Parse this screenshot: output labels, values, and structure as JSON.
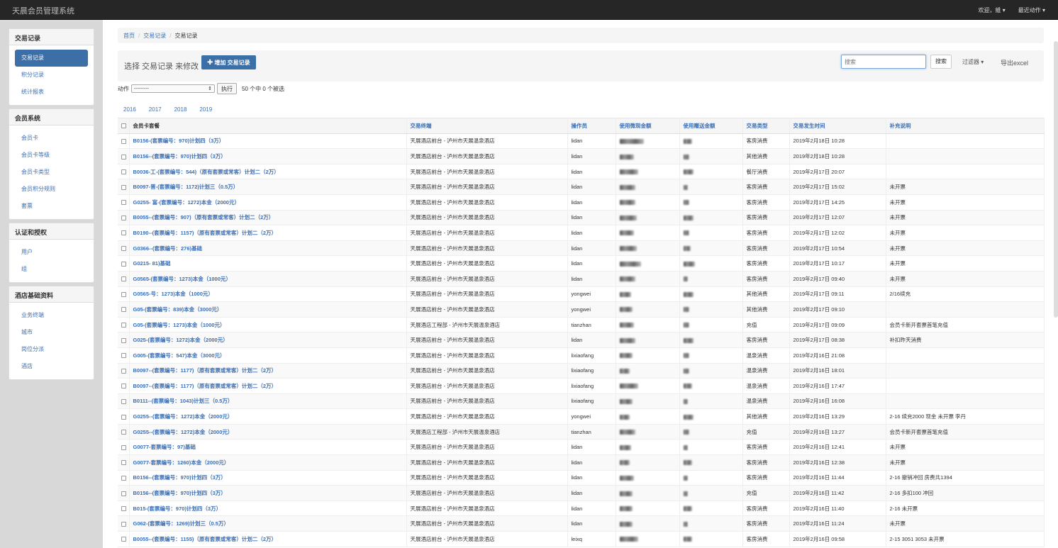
{
  "app": {
    "title": "天晨会员管理系统",
    "welcome": "欢迎，",
    "user": "維",
    "recent": "最近动作"
  },
  "sidebar": [
    {
      "heading": "交易记录",
      "items": [
        {
          "label": "交易记录",
          "active": true
        },
        {
          "label": "积分记录"
        },
        {
          "label": "统计报表"
        }
      ]
    },
    {
      "heading": "会员系统",
      "items": [
        {
          "label": "会员卡"
        },
        {
          "label": "会员卡等级"
        },
        {
          "label": "会员卡类型"
        },
        {
          "label": "会员积分规则"
        },
        {
          "label": "套票"
        }
      ]
    },
    {
      "heading": "认证和授权",
      "items": [
        {
          "label": "用户"
        },
        {
          "label": "组"
        }
      ]
    },
    {
      "heading": "酒店基础资料",
      "items": [
        {
          "label": "业务终端"
        },
        {
          "label": "城市"
        },
        {
          "label": "岗位分派"
        },
        {
          "label": "酒店"
        }
      ]
    }
  ],
  "breadcrumb": {
    "home": "首页",
    "section": "交易记录",
    "current": "交易记录"
  },
  "toolbar": {
    "title": "选择 交易记录 来修改",
    "add_label": "增加 交易记录",
    "search_placeholder": "搜索",
    "search_label": "搜索",
    "filter_label": "过滤器",
    "export_label": "导出excel"
  },
  "actions": {
    "label": "动作",
    "select_value": "---------",
    "go_label": "执行",
    "selection_info": "50 个中 0 个被选"
  },
  "years": [
    "2016",
    "2017",
    "2018",
    "2019"
  ],
  "table": {
    "headers": [
      "会员卡套餐",
      "交易终端",
      "操作员",
      "使用微现金额",
      "使用赠送金额",
      "交易类型",
      "交易发生时间",
      "补充说明"
    ],
    "rows": [
      {
        "card": "B0156-(套票编号：970)计划四（3万）",
        "terminal": "天展酒店前台 - 泸州市天展温泉酒店",
        "op": "lidan",
        "type": "客房消费",
        "time": "2019年2月18日 10:28",
        "note": ""
      },
      {
        "card": "B0156--(套票编号：970)计划四（3万）",
        "terminal": "天展酒店前台 - 泸州市天展温泉酒店",
        "op": "lidan",
        "type": "其他消费",
        "time": "2019年2月18日 10:28",
        "note": ""
      },
      {
        "card": "B0036-工-(套票编号：544)（原有套票或常客）计划二（2万）",
        "terminal": "天展酒店前台 - 泸州市天展温泉酒店",
        "op": "lidan",
        "type": "餐厅消费",
        "time": "2019年2月17日 20:07",
        "note": ""
      },
      {
        "card": "B0097-晋-(套票编号：1172)计划三（0.5万）",
        "terminal": "天展酒店前台 - 泸州市天展温泉酒店",
        "op": "lidan",
        "type": "客房消费",
        "time": "2019年2月17日 15:02",
        "note": "未开票"
      },
      {
        "card": "G0255- 富-(套票编号：1272)本金（2000元）",
        "terminal": "天展酒店前台 - 泸州市天展温泉酒店",
        "op": "lidan",
        "type": "客房消费",
        "time": "2019年2月17日 14:25",
        "note": "未开票"
      },
      {
        "card": "B0055--(套票编号：907)（原有套票或常客）计划二（2万）",
        "terminal": "天展酒店前台 - 泸州市天展温泉酒店",
        "op": "lidan",
        "type": "客房消费",
        "time": "2019年2月17日 12:07",
        "note": "未开票"
      },
      {
        "card": "B0190--(套票编号：1157)（原有套票或常客）计划二（2万）",
        "terminal": "天展酒店前台 - 泸州市天展温泉酒店",
        "op": "lidan",
        "type": "客房消费",
        "time": "2019年2月17日 12:02",
        "note": "未开票"
      },
      {
        "card": "G0366--(套票编号：276)基础",
        "terminal": "天展酒店前台 - 泸州市天展温泉酒店",
        "op": "lidan",
        "type": "客房消费",
        "time": "2019年2月17日 10:54",
        "note": "未开票"
      },
      {
        "card": "G0215- 81)基础",
        "terminal": "天展酒店前台 - 泸州市天展温泉酒店",
        "op": "lidan",
        "type": "客房消费",
        "time": "2019年2月17日 10:17",
        "note": "未开票"
      },
      {
        "card": "G0565-(套票编号：1273)本金（1000元）",
        "terminal": "天展酒店前台 - 泸州市天展温泉酒店",
        "op": "lidan",
        "type": "客房消费",
        "time": "2019年2月17日 09:40",
        "note": "未开票"
      },
      {
        "card": "G0565-号：1273)本金（1000元）",
        "terminal": "天展酒店前台 - 泸州市天展温泉酒店",
        "op": "yongwei",
        "type": "其他消费",
        "time": "2019年2月17日 09:11",
        "note": "2/16续充"
      },
      {
        "card": "G05-(套票编号：839)本金（3000元）",
        "terminal": "天展酒店前台 - 泸州市天展温泉酒店",
        "op": "yongwei",
        "type": "其他消费",
        "time": "2019年2月17日 09:10",
        "note": ""
      },
      {
        "card": "G05-(套票编号：1273)本金（1000元）",
        "terminal": "天展酒店工程部 - 泸州市天展温泉酒店",
        "op": "tianzhan",
        "type": "充值",
        "time": "2019年2月17日 09:09",
        "note": "会员卡新开套票首笔充值"
      },
      {
        "card": "G025-(套票编号：1272)本金（2000元）",
        "terminal": "天展酒店前台 - 泸州市天展温泉酒店",
        "op": "lidan",
        "type": "客房消费",
        "time": "2019年2月17日 08:38",
        "note": "补扣昨天消费"
      },
      {
        "card": "G005-(套票编号：547)本金（3000元）",
        "terminal": "天展酒店前台 - 泸州市天展温泉酒店",
        "op": "lixiaofang",
        "type": "温泉消费",
        "time": "2019年2月16日 21:08",
        "note": ""
      },
      {
        "card": "B0097--(套票编号：1177)（原有套票或常客）计划二（2万）",
        "terminal": "天展酒店前台 - 泸州市天展温泉酒店",
        "op": "lixiaofang",
        "type": "温泉消费",
        "time": "2019年2月16日 18:01",
        "note": ""
      },
      {
        "card": "B0097--(套票编号：1177)（原有套票或常客）计划二（2万）",
        "terminal": "天展酒店前台 - 泸州市天展温泉酒店",
        "op": "lixiaofang",
        "type": "温泉消费",
        "time": "2019年2月16日 17:47",
        "note": ""
      },
      {
        "card": "B0111--(套票编号：1043)计划三（0.5万）",
        "terminal": "天展酒店前台 - 泸州市天展温泉酒店",
        "op": "lixiaofang",
        "type": "温泉消费",
        "time": "2019年2月16日 16:08",
        "note": ""
      },
      {
        "card": "G0255--(套票编号：1272)本金（2000元）",
        "terminal": "天展酒店前台 - 泸州市天展温泉酒店",
        "op": "yongwei",
        "type": "其他消费",
        "time": "2019年2月16日 13:29",
        "note": "2-16 续充2000 现金 未开票 李丹"
      },
      {
        "card": "G0255--(套票编号：1272)本金（2000元）",
        "terminal": "天展酒店工程部 - 泸州市天展温泉酒店",
        "op": "tianzhan",
        "type": "充值",
        "time": "2019年2月16日 13:27",
        "note": "会员卡新开套票首笔充值"
      },
      {
        "card": "G0077-套票编号：97)基础",
        "terminal": "天展酒店前台 - 泸州市天展温泉酒店",
        "op": "lidan",
        "type": "客房消费",
        "time": "2019年2月16日 12:41",
        "note": "未开票"
      },
      {
        "card": "G0077-套票编号：1260)本金（2000元）",
        "terminal": "天展酒店前台 - 泸州市天展温泉酒店",
        "op": "lidan",
        "type": "客房消费",
        "time": "2019年2月16日 12:38",
        "note": "未开票"
      },
      {
        "card": "B0156--(套票编号：970)计划四（3万）",
        "terminal": "天展酒店前台 - 泸州市天展温泉酒店",
        "op": "lidan",
        "type": "客房消费",
        "time": "2019年2月16日 11:44",
        "note": "2-16 撤销冲回 房费共1394"
      },
      {
        "card": "B0156--(套票编号：970)计划四（3万）",
        "terminal": "天展酒店前台 - 泸州市天展温泉酒店",
        "op": "lidan",
        "type": "充值",
        "time": "2019年2月16日 11:42",
        "note": "2-16 多扣100 冲回"
      },
      {
        "card": "B015-(套票编号：970)计划四（3万）",
        "terminal": "天展酒店前台 - 泸州市天展温泉酒店",
        "op": "lidan",
        "type": "客房消费",
        "time": "2019年2月16日 11:40",
        "note": "2-16 未开票"
      },
      {
        "card": "G062-(套票编号：1269)计划三（0.5万）",
        "terminal": "天展酒店前台 - 泸州市天展温泉酒店",
        "op": "lidan",
        "type": "客房消费",
        "time": "2019年2月16日 11:24",
        "note": "未开票"
      },
      {
        "card": "B0055--(套票编号：1155)（原有套票或常客）计划二（2万）",
        "terminal": "天展酒店前台 - 泸州市天展温泉酒店",
        "op": "leixq",
        "type": "客房消费",
        "time": "2019年2月16日 09:58",
        "note": "2-15 3051 3053 未开票"
      }
    ]
  }
}
